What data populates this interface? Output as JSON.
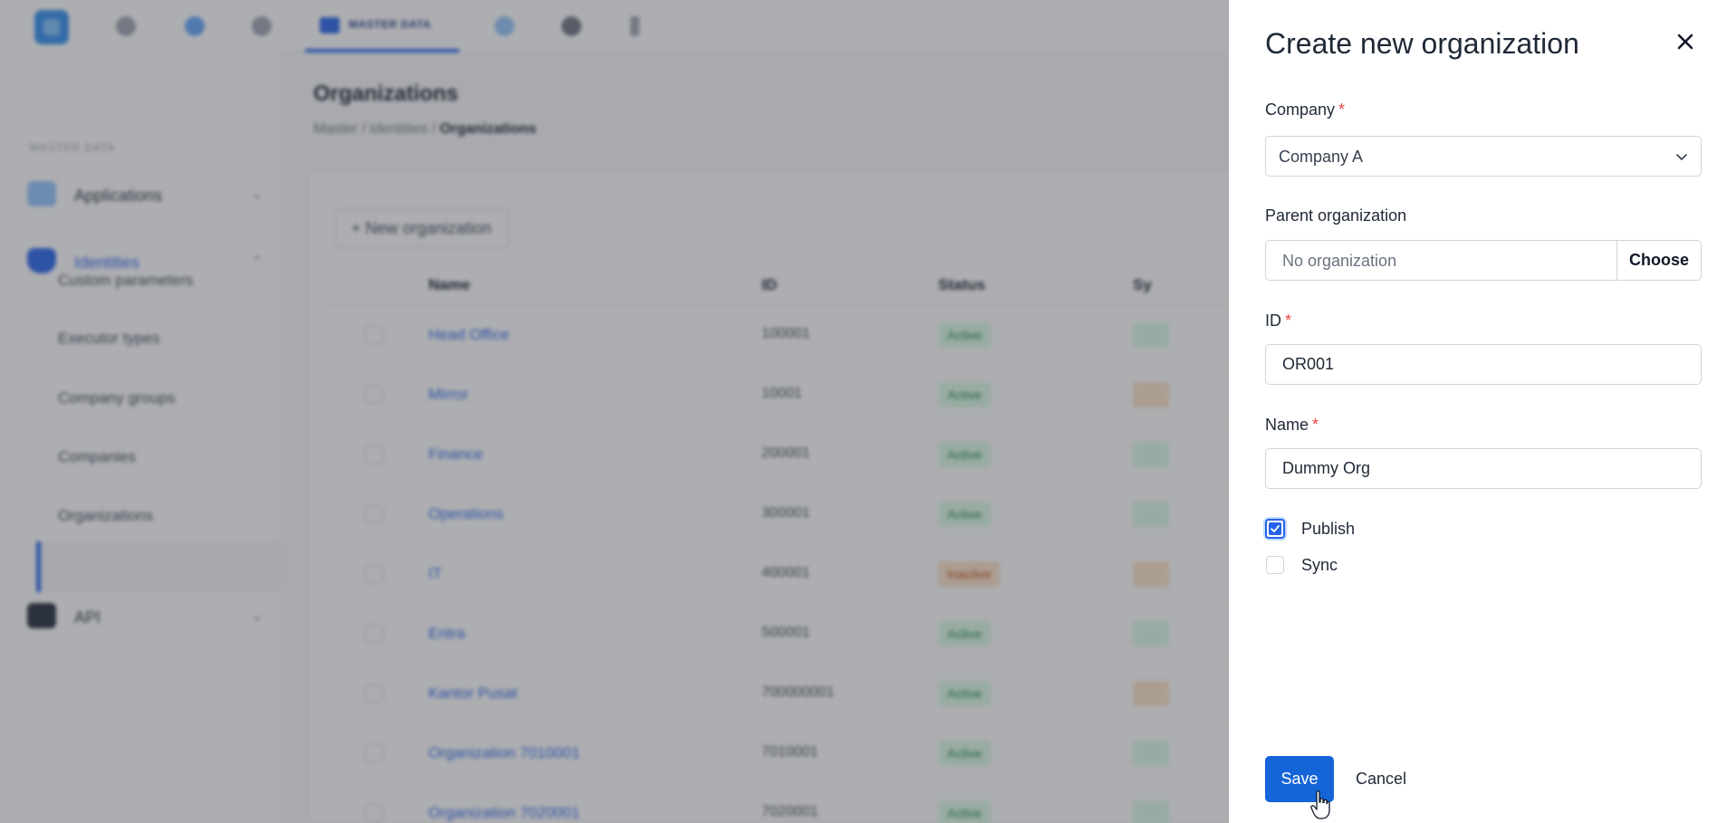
{
  "app": {
    "active_tab": "MASTER DATA"
  },
  "sidebar": {
    "section": "MASTER DATA",
    "groups": [
      {
        "label": "Applications"
      },
      {
        "label": "Identities"
      },
      {
        "label": "API"
      }
    ],
    "sub_items": [
      "Custom parameters",
      "Executor types",
      "Company groups",
      "Companies",
      "Organizations"
    ]
  },
  "main": {
    "title": "Organizations",
    "breadcrumb": [
      "Master",
      "Identities",
      "Organizations"
    ],
    "new_button": "+ New organization",
    "columns": [
      "Name",
      "ID",
      "Status",
      "Sy"
    ],
    "rows": [
      {
        "name": "Head Office",
        "id": "100001",
        "status": "Active"
      },
      {
        "name": "Mirror",
        "id": "10001",
        "status": "Active"
      },
      {
        "name": "Finance",
        "id": "200001",
        "status": "Active"
      },
      {
        "name": "Operations",
        "id": "300001",
        "status": "Active"
      },
      {
        "name": "IT",
        "id": "400001",
        "status": "Inactive"
      },
      {
        "name": "Entra",
        "id": "500001",
        "status": "Active"
      },
      {
        "name": "Kantor Pusat",
        "id": "700000001",
        "status": "Active"
      },
      {
        "name": "Organization 7010001",
        "id": "7010001",
        "status": "Active"
      },
      {
        "name": "Organization 7020001",
        "id": "7020001",
        "status": "Active"
      }
    ]
  },
  "drawer": {
    "title": "Create new organization",
    "company": {
      "label": "Company",
      "value": "Company A"
    },
    "parent": {
      "label": "Parent organization",
      "placeholder": "No organization",
      "button": "Choose"
    },
    "id_field": {
      "label": "ID",
      "value": "OR001"
    },
    "name_field": {
      "label": "Name",
      "value": "Dummy Org"
    },
    "publish": {
      "label": "Publish",
      "checked": true
    },
    "sync": {
      "label": "Sync",
      "checked": false
    },
    "save": "Save",
    "cancel": "Cancel",
    "required_mark": "*"
  },
  "colors": {
    "primary": "#1565d8",
    "required": "#ef4444",
    "overlay": "#3c3e44"
  }
}
